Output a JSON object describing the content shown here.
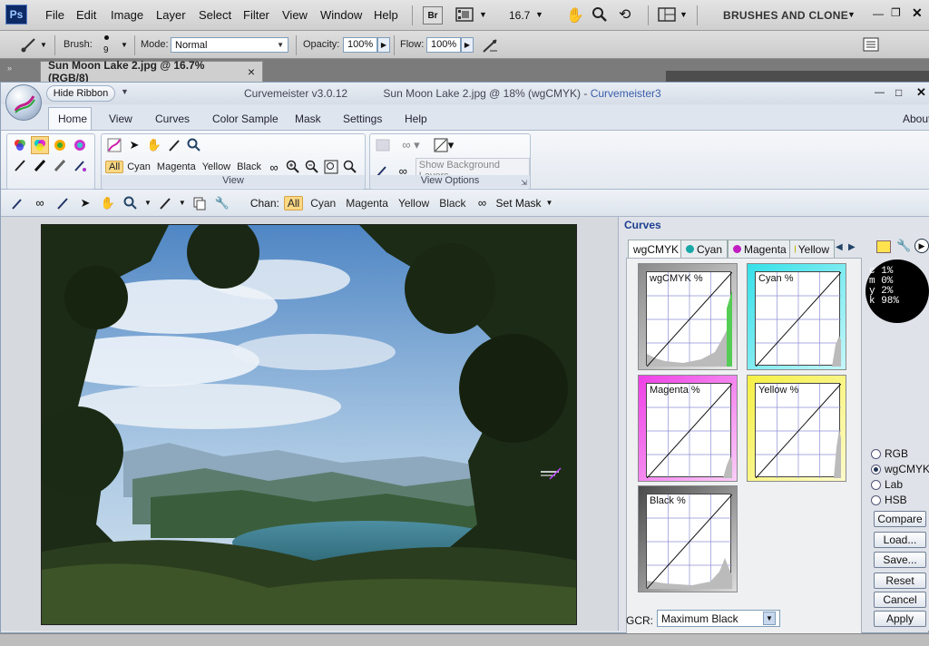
{
  "ps": {
    "logo": "Ps",
    "menu": [
      "File",
      "Edit",
      "Image",
      "Layer",
      "Select",
      "Filter",
      "View",
      "Window",
      "Help"
    ],
    "br": "Br",
    "zoom": "16.7",
    "workspace": "BRUSHES AND CLONE",
    "options": {
      "brush_label": "Brush:",
      "brush_size": "9",
      "mode_label": "Mode:",
      "mode_value": "Normal",
      "opacity_label": "Opacity:",
      "opacity_value": "100%",
      "flow_label": "Flow:",
      "flow_value": "100%"
    },
    "doc_tab": "Sun Moon Lake 2.jpg @ 16.7% (RGB/8)",
    "doc_close": "×"
  },
  "cm": {
    "hide_ribbon": "Hide Ribbon",
    "title_app": "Curvemeister v3.0.12",
    "title_doc": "Sun Moon Lake 2.jpg @ 18% (wgCMYK) -",
    "title_accent": "Curvemeister3",
    "tabs": [
      "Home",
      "View",
      "Curves",
      "Color Sample",
      "Mask",
      "Settings",
      "Help"
    ],
    "about": "About",
    "ribbon": {
      "view_group": "View",
      "view_options_group": "View Options",
      "channels": [
        "All",
        "Cyan",
        "Magenta",
        "Yellow",
        "Black"
      ],
      "show_bg_layers": "Show Background Layers"
    },
    "toolbar": {
      "chan_label": "Chan:",
      "channels": [
        "All",
        "Cyan",
        "Magenta",
        "Yellow",
        "Black"
      ],
      "set_mask": "Set Mask"
    }
  },
  "curves": {
    "header": "Curves",
    "tabs": [
      {
        "label": "wgCMYK",
        "color": ""
      },
      {
        "label": "Cyan",
        "color": "#1aa7a7"
      },
      {
        "label": "Magenta",
        "color": "#c01ec0"
      },
      {
        "label": "Yellow",
        "color": "#b8b800"
      }
    ],
    "cells": [
      {
        "label": "wgCMYK %",
        "frame": "#5a5a5a"
      },
      {
        "label": "Cyan %",
        "frame": "#35e0e8"
      },
      {
        "label": "Magenta %",
        "frame": "#ee3fe6"
      },
      {
        "label": "Yellow %",
        "frame": "#f5f044"
      },
      {
        "label": "Black %",
        "frame": "#4a4a4a"
      }
    ],
    "readout": {
      "c": "c   1%",
      "m": "m   0%",
      "y": "y   2%",
      "k": "k  98%"
    },
    "color_modes": [
      "RGB",
      "wgCMYK",
      "Lab",
      "HSB"
    ],
    "selected_mode": "wgCMYK",
    "buttons": [
      "Compare",
      "Load...",
      "Save...",
      "Reset",
      "Cancel",
      "Apply"
    ],
    "gcr_label": "GCR:",
    "gcr_value": "Maximum Black"
  }
}
